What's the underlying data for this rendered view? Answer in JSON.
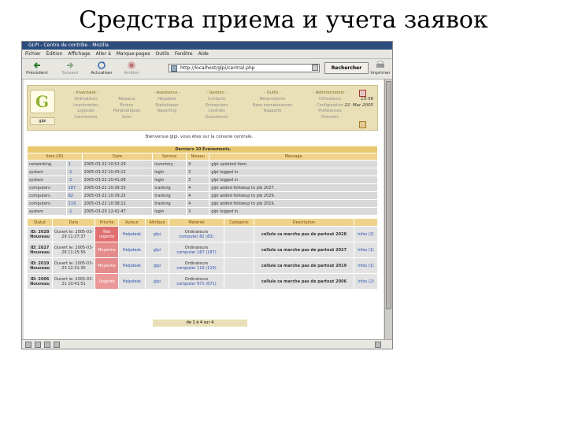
{
  "slide_title": "Средства приема и учета заявок",
  "window": {
    "title": "GLPI - Centre de contrôle - Mozilla"
  },
  "menu": [
    "Fichier",
    "Édition",
    "Affichage",
    "Aller à",
    "Marque-pages",
    "Outils",
    "Fenêtre",
    "Aide"
  ],
  "toolbar": {
    "back": "Précédent",
    "forward": "Suivant",
    "reload": "Actualiser",
    "stop": "Arrêter",
    "url": "http://localhost/glpi/central.php",
    "search": "Rechercher",
    "print": "Imprimer"
  },
  "header": {
    "user": "glpi",
    "groups": [
      {
        "title": "- Inventaire -",
        "items": [
          "Ordinateurs",
          "Imprimantes",
          "Logiciels",
          "Connexions"
        ]
      },
      {
        "title": "- Assistance -",
        "items": [
          "Réseaux",
          "Écrans",
          "Périphériques",
          "Suivi",
          "Helpdesk",
          "Statistiques",
          "Reporting"
        ]
      },
      {
        "title": "- Gestion -",
        "items": [
          "Contacts",
          "Entreprises",
          "Contrats",
          "Documents"
        ]
      },
      {
        "title": "- Outils -",
        "items": [
          "Réservations",
          "Base connaissances",
          "Rapports"
        ]
      },
      {
        "title": "- Administration -",
        "items": [
          "Utilisateurs",
          "Configuration",
          "Préférences",
          "Données"
        ]
      }
    ],
    "time": "10:58",
    "date": "22. Mar 2005"
  },
  "welcome": "Bienvenue glpi, vous êtes sur la console centrale.",
  "events": {
    "caption": "Derniers 10 Événements.",
    "headers": [
      "Item (ID)",
      "Date",
      "Service",
      "Niveau",
      "Message"
    ],
    "rows": [
      [
        "networking",
        "1",
        "2005-03-22 10:52:29",
        "inventory",
        "4",
        "glpi updated item."
      ],
      [
        "system",
        "-1",
        "2005-03-22 10:43:12",
        "login",
        "3",
        "glpi logged in."
      ],
      [
        "system",
        "-1",
        "2005-03-22 10:41:06",
        "login",
        "3",
        "glpi logged in."
      ],
      [
        "computers",
        "187",
        "2005-03-22 10:39:33",
        "tracking",
        "4",
        "glpi added followup to job 2027."
      ],
      [
        "computers",
        "82",
        "2005-03-22 10:39:25",
        "tracking",
        "4",
        "glpi added followup to job 2029."
      ],
      [
        "computers",
        "119",
        "2005-03-22 10:38:12",
        "tracking",
        "4",
        "glpi added followup to job 2019."
      ],
      [
        "system",
        "-1",
        "2005-03-20 12:41:47",
        "login",
        "3",
        "glpi logged in."
      ]
    ]
  },
  "tracking": {
    "headers": [
      "Statut",
      "Date",
      "Priorité",
      "Auteur",
      "Attribué",
      "Matériel",
      "Catégorie",
      "Description"
    ],
    "rows": [
      {
        "id": "ID: 2028",
        "status": "Nouveau",
        "opened": "Ouvert le: 2005-03-29 11:37:37",
        "priority": "Très urgente",
        "author": "Helpdesk",
        "assigned": "glpi",
        "device": "Ordinateurs",
        "device_link": "computer 82 (82)",
        "category": "",
        "desc": "cellule ca marche pas de partout 2028",
        "followups": "Infos (2)"
      },
      {
        "id": "ID: 2027",
        "status": "Nouveau",
        "opened": "Ouvert le: 2005-03-28 11:25:56",
        "priority": "Moyenne",
        "author": "Helpdesk",
        "assigned": "glpi",
        "device": "Ordinateurs",
        "device_link": "computer 187 (187)",
        "category": "",
        "desc": "cellule ca marche pas de partout 2027",
        "followups": "Infos (1)"
      },
      {
        "id": "ID: 2019",
        "status": "Nouveau",
        "opened": "Ouvert le: 2005-03-23 12:31:30",
        "priority": "Moyenne",
        "author": "Helpdesk",
        "assigned": "glpi",
        "device": "Ordinateurs",
        "device_link": "computer 119 (119)",
        "category": "",
        "desc": "cellule ca marche pas de partout 2019",
        "followups": "Infos (1)"
      },
      {
        "id": "ID: 2006",
        "status": "Nouveau",
        "opened": "Ouvert le: 2005-03-21 10:41:51",
        "priority": "Urgente",
        "author": "Helpdesk",
        "assigned": "glpi",
        "device": "Ordinateurs",
        "device_link": "computer 671 (671)",
        "category": "",
        "desc": "cellule ca marche pas de partout 2006",
        "followups": "Infos (2)"
      }
    ]
  },
  "pager": "de 1 à 4 sur 4"
}
